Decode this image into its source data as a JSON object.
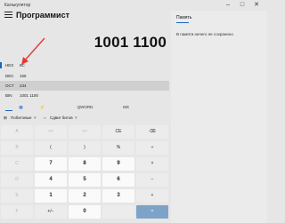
{
  "window": {
    "title": "Калькулятор",
    "minimize_icon": "minimize-icon",
    "maximize_icon": "maximize-icon",
    "close_icon": "close-icon"
  },
  "header": {
    "mode_title": "Программист",
    "menu_icon": "hamburger-icon",
    "mode_icon": "keep-on-top-icon"
  },
  "display": {
    "value": "1001 1100"
  },
  "bases": [
    {
      "name": "HEX",
      "value": "9C"
    },
    {
      "name": "DEC",
      "value": "156"
    },
    {
      "name": "OCT",
      "value": "234"
    },
    {
      "name": "BIN",
      "value": "1001 1100"
    }
  ],
  "tabs": {
    "active": "keypad-icon",
    "bit_toggle": "bit-toggle-icon",
    "word": "QWORD",
    "memory": "MS"
  },
  "bitops": {
    "bitwise": "Побитовые",
    "shift": "Сдвиг битов"
  },
  "keys": [
    [
      "A",
      "<<",
      ">>",
      "CE",
      "⌫"
    ],
    [
      "B",
      "(",
      ")",
      "%",
      "÷"
    ],
    [
      "C",
      "7",
      "8",
      "9",
      "×"
    ],
    [
      "D",
      "4",
      "5",
      "6",
      "−"
    ],
    [
      "E",
      "1",
      "2",
      "3",
      "+"
    ],
    [
      "F",
      "+/−",
      "0",
      ".",
      "="
    ]
  ],
  "memory": {
    "tab_label": "Память",
    "empty_text": "В памяти ничего не сохранено"
  },
  "colors": {
    "accent": "#1565c0",
    "equals": "#7ea3c8",
    "arrow": "#e53935"
  }
}
